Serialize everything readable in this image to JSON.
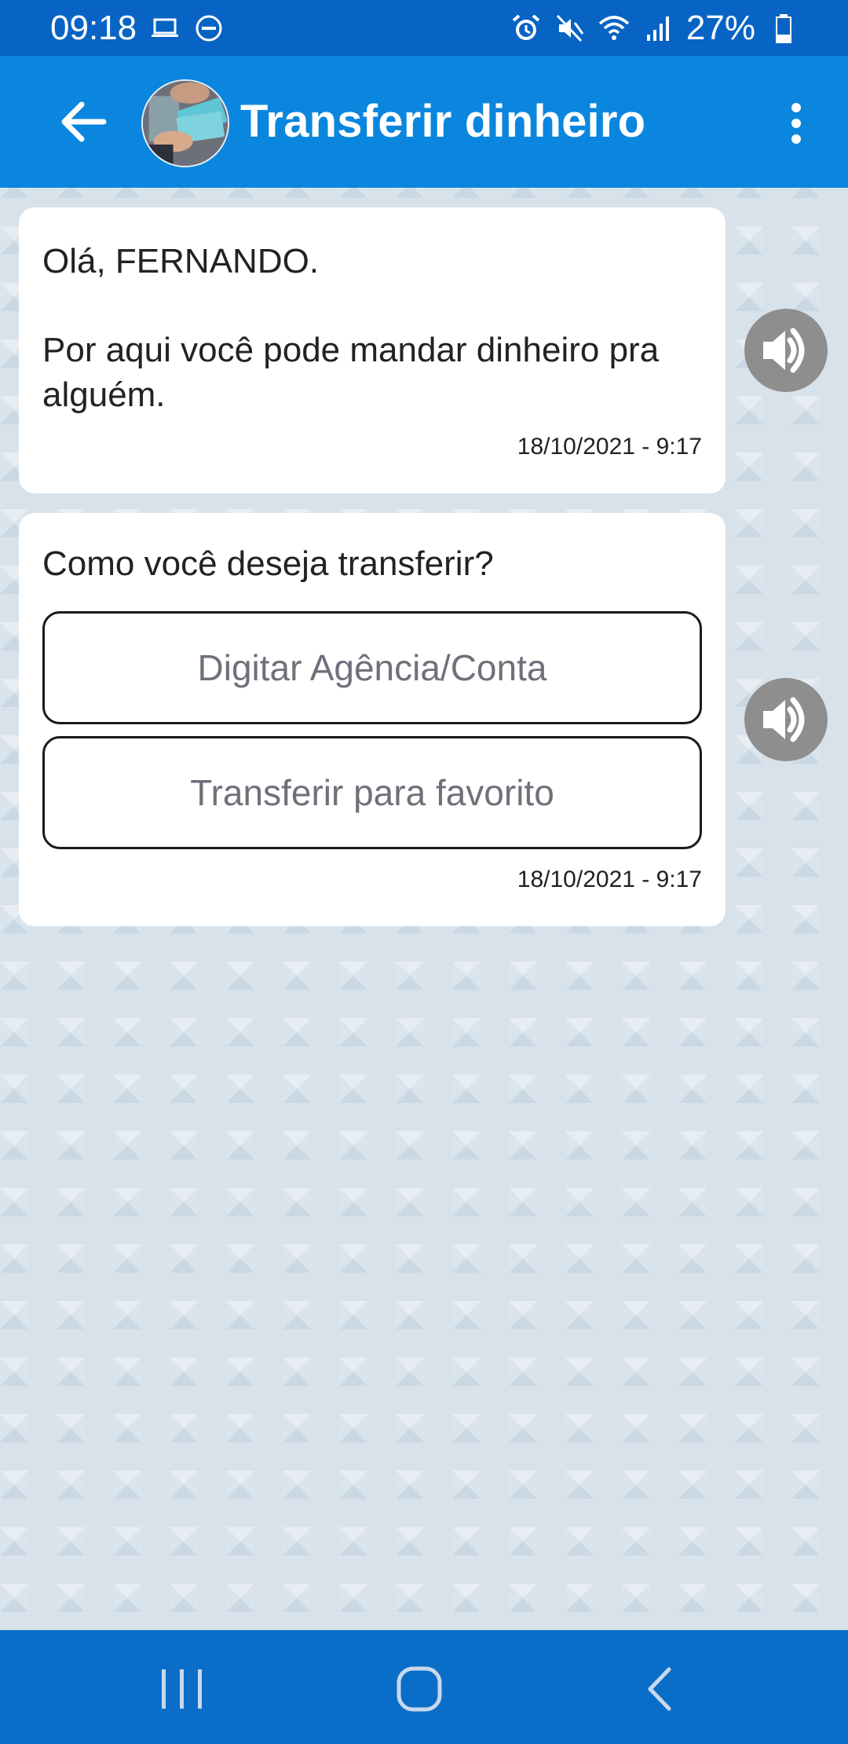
{
  "status_bar": {
    "time": "09:18",
    "battery": "27%",
    "icons": [
      "laptop-icon",
      "do-not-disturb-icon",
      "alarm-icon",
      "mute-icon",
      "wifi-icon",
      "signal-icon",
      "battery-icon"
    ]
  },
  "app_bar": {
    "title": "Transferir dinheiro",
    "back_icon": "arrow-left-icon",
    "menu_icon": "more-vert-icon",
    "colors": {
      "app_bar": "#0a86de",
      "status_bar": "#0864c4",
      "nav_bar": "#0a6ec9"
    }
  },
  "messages": [
    {
      "greeting": "Olá, FERNANDO.",
      "text": "Por aqui você pode mandar dinheiro pra alguém.",
      "timestamp": "18/10/2021 - 9:17"
    },
    {
      "question": "Como você deseja transferir?",
      "options": [
        "Digitar Agência/Conta",
        "Transferir para favorito"
      ],
      "timestamp": "18/10/2021 - 9:17"
    }
  ],
  "nav_bar": {
    "icons": [
      "recent-apps-icon",
      "home-icon",
      "back-icon"
    ]
  }
}
